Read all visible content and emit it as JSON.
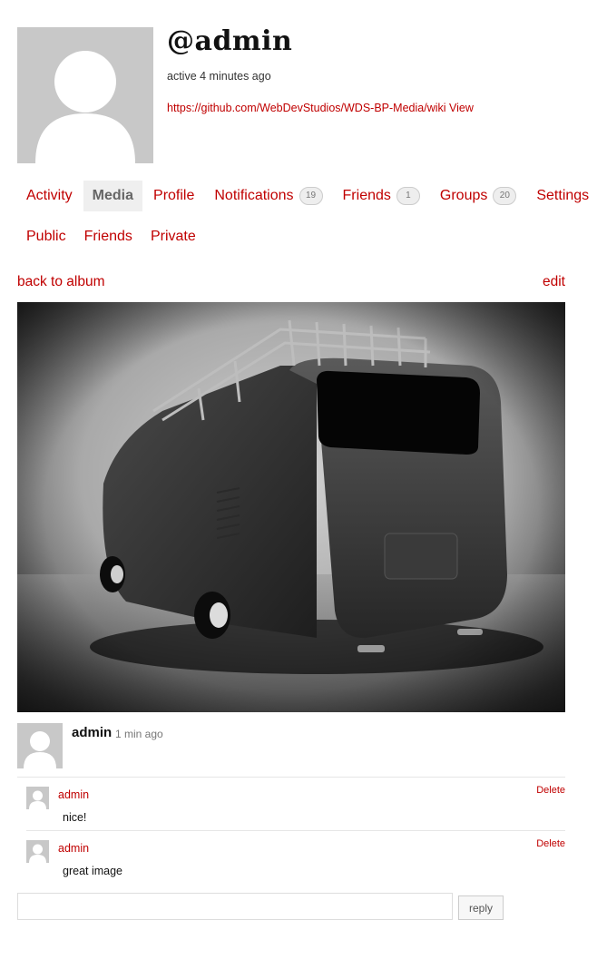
{
  "profile": {
    "username": "@admin",
    "active": "active 4 minutes ago",
    "url": "https://github.com/WebDevStudios/WDS-BP-Media/wiki",
    "url_suffix": " View"
  },
  "nav": {
    "primary": [
      {
        "label": "Activity",
        "count": null,
        "selected": false
      },
      {
        "label": "Media",
        "count": null,
        "selected": true
      },
      {
        "label": "Profile",
        "count": null,
        "selected": false
      },
      {
        "label": "Notifications",
        "count": "19",
        "selected": false
      },
      {
        "label": "Friends",
        "count": "1",
        "selected": false
      },
      {
        "label": "Groups",
        "count": "20",
        "selected": false
      },
      {
        "label": "Settings",
        "count": null,
        "selected": false
      }
    ],
    "secondary": [
      {
        "label": "Public"
      },
      {
        "label": "Friends"
      },
      {
        "label": "Private"
      }
    ]
  },
  "media": {
    "back_label": "back to album",
    "edit_label": "edit",
    "image_icon": "vw-bus-photo"
  },
  "activity": {
    "author": "admin",
    "time": "1 min ago",
    "comments": [
      {
        "author": "admin",
        "text": "nice!",
        "delete_label": "Delete"
      },
      {
        "author": "admin",
        "text": "great image",
        "delete_label": "Delete"
      }
    ],
    "reply_placeholder": "",
    "reply_label": "reply"
  },
  "colors": {
    "link": "#c00000",
    "avatar_bg": "#c8c8c8",
    "selected_tab_bg": "#efefef"
  }
}
